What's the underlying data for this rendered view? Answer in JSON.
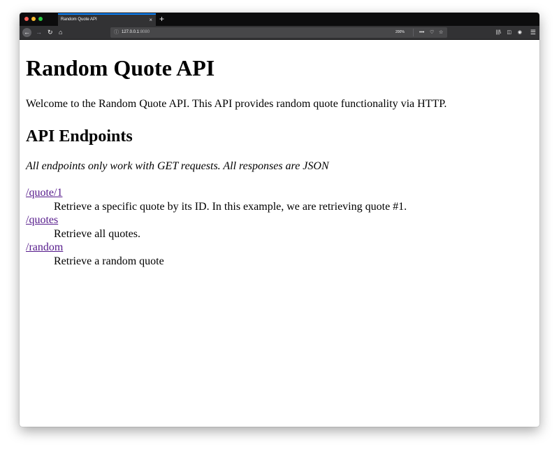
{
  "browser": {
    "tab_title": "Random Quote API",
    "new_tab_label": "+",
    "close_tab_label": "×",
    "url_host": "127.0.0.1",
    "url_port": ":8080",
    "zoom": "200%",
    "colors": {
      "tabbar": "#0c0c0d",
      "toolbar": "#323234",
      "tab_accent": "#0a84ff",
      "close_dot": "#ff5f57",
      "minimize_dot": "#febc2e",
      "zoom_dot": "#28c840"
    }
  },
  "page": {
    "title": "Random Quote API",
    "welcome": "Welcome to the Random Quote API. This API provides random quote functionality via HTTP.",
    "endpoints_heading": "API Endpoints",
    "note": "All endpoints only work with GET requests. All responses are JSON",
    "endpoints": [
      {
        "path": "/quote/1",
        "description": "Retrieve a specific quote by its ID. In this example, we are retrieving quote #1."
      },
      {
        "path": "/quotes",
        "description": "Retrieve all quotes."
      },
      {
        "path": "/random",
        "description": "Retrieve a random quote"
      }
    ],
    "link_color": "#551a8b"
  }
}
